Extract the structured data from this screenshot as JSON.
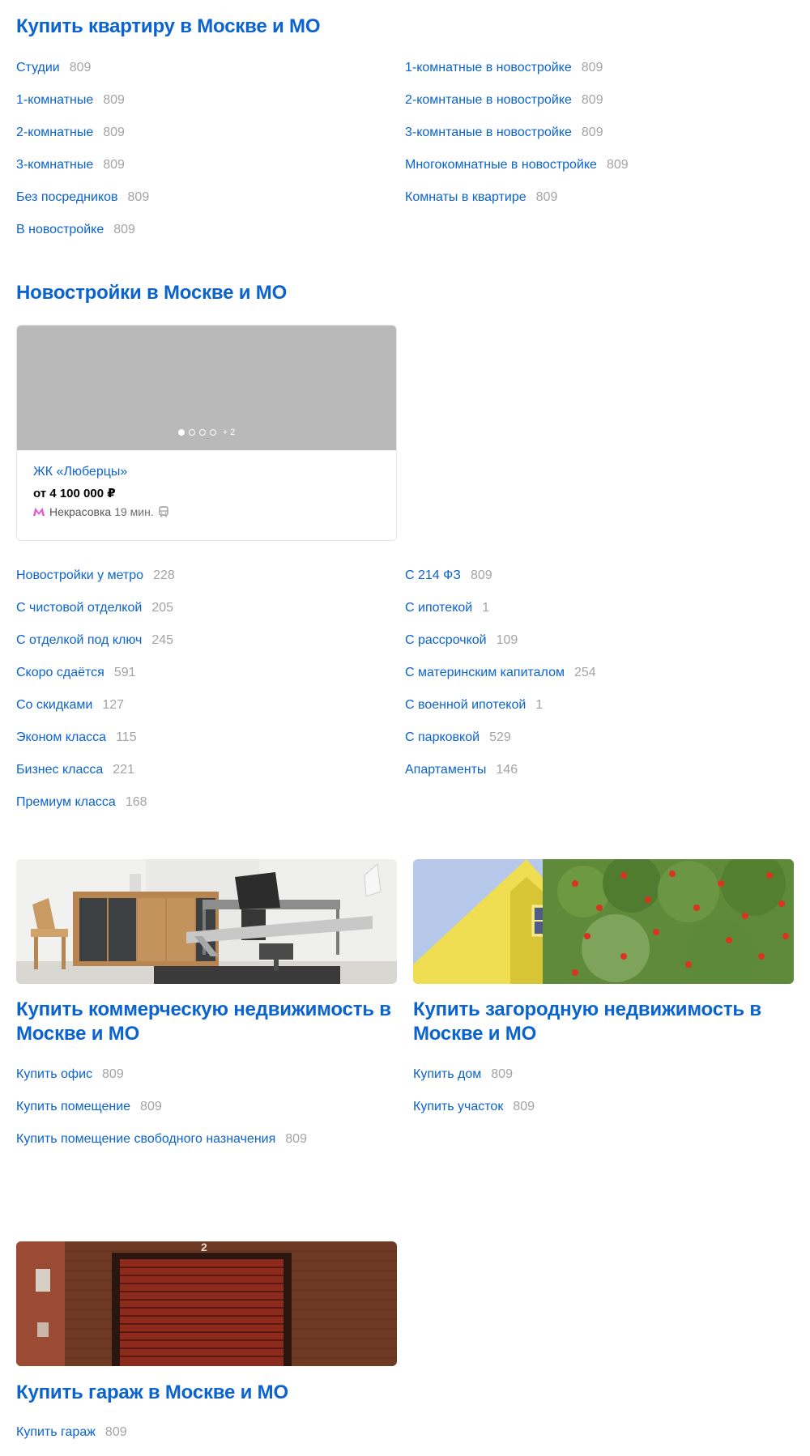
{
  "apartments": {
    "title": "Купить квартиру в Москве и МО",
    "left": [
      {
        "label": "Студии",
        "count": "809"
      },
      {
        "label": "1-комнатные",
        "count": "809"
      },
      {
        "label": "2-комнатные",
        "count": "809"
      },
      {
        "label": "3-комнатные",
        "count": "809"
      },
      {
        "label": "Без посредников",
        "count": "809"
      },
      {
        "label": "В новостройке",
        "count": "809"
      }
    ],
    "right": [
      {
        "label": "1-комнатные в новостройке",
        "count": "809"
      },
      {
        "label": "2-комнтаные в новостройке",
        "count": "809"
      },
      {
        "label": "3-комнтаные в новостройке",
        "count": "809"
      },
      {
        "label": "Многокомнатные в новостройке",
        "count": "809"
      },
      {
        "label": "Комнаты в квартире",
        "count": "809"
      }
    ]
  },
  "newbuildings": {
    "title": "Новостройки в Москве и МО",
    "card": {
      "title": "ЖК «Люберцы»",
      "price": "от 4 100 000 ₽",
      "metro": "Некрасовка",
      "time": "19 мин.",
      "more_photos": "+ 2",
      "metro_color": "#e84fd7"
    },
    "left": [
      {
        "label": "Новостройки у метро",
        "count": "228"
      },
      {
        "label": "С чистовой отделкой",
        "count": "205"
      },
      {
        "label": "С отделкой под ключ",
        "count": "245"
      },
      {
        "label": "Скоро сдаётся",
        "count": "591"
      },
      {
        "label": "Со скидками",
        "count": "127"
      },
      {
        "label": "Эконом класса",
        "count": "115"
      },
      {
        "label": "Бизнес класса",
        "count": "221"
      },
      {
        "label": "Премиум класса",
        "count": "168"
      }
    ],
    "right": [
      {
        "label": "С 214 ФЗ",
        "count": "809"
      },
      {
        "label": "С ипотекой",
        "count": "1"
      },
      {
        "label": "С рассрочкой",
        "count": "109"
      },
      {
        "label": "С материнским капиталом",
        "count": "254"
      },
      {
        "label": "С военной ипотекой",
        "count": "1"
      },
      {
        "label": "С парковкой",
        "count": "529"
      },
      {
        "label": "Апартаменты",
        "count": "146"
      }
    ]
  },
  "commercial": {
    "title": "Купить коммерческую недвижимость в Москве и МО",
    "items": [
      {
        "label": "Купить офис",
        "count": "809"
      },
      {
        "label": "Купить помещение",
        "count": "809"
      },
      {
        "label": "Купить помещение свободного назначения",
        "count": "809"
      }
    ]
  },
  "country": {
    "title": "Купить загородную недвижимость в Москве и МО",
    "items": [
      {
        "label": "Купить дом",
        "count": "809"
      },
      {
        "label": "Купить участок",
        "count": "809"
      }
    ]
  },
  "garage": {
    "title": "Купить гараж в Москве и МО",
    "door_number": "2",
    "items": [
      {
        "label": "Купить гараж",
        "count": "809"
      }
    ]
  },
  "colors": {
    "link": "#0a63cf",
    "count": "#a3a3a3"
  }
}
